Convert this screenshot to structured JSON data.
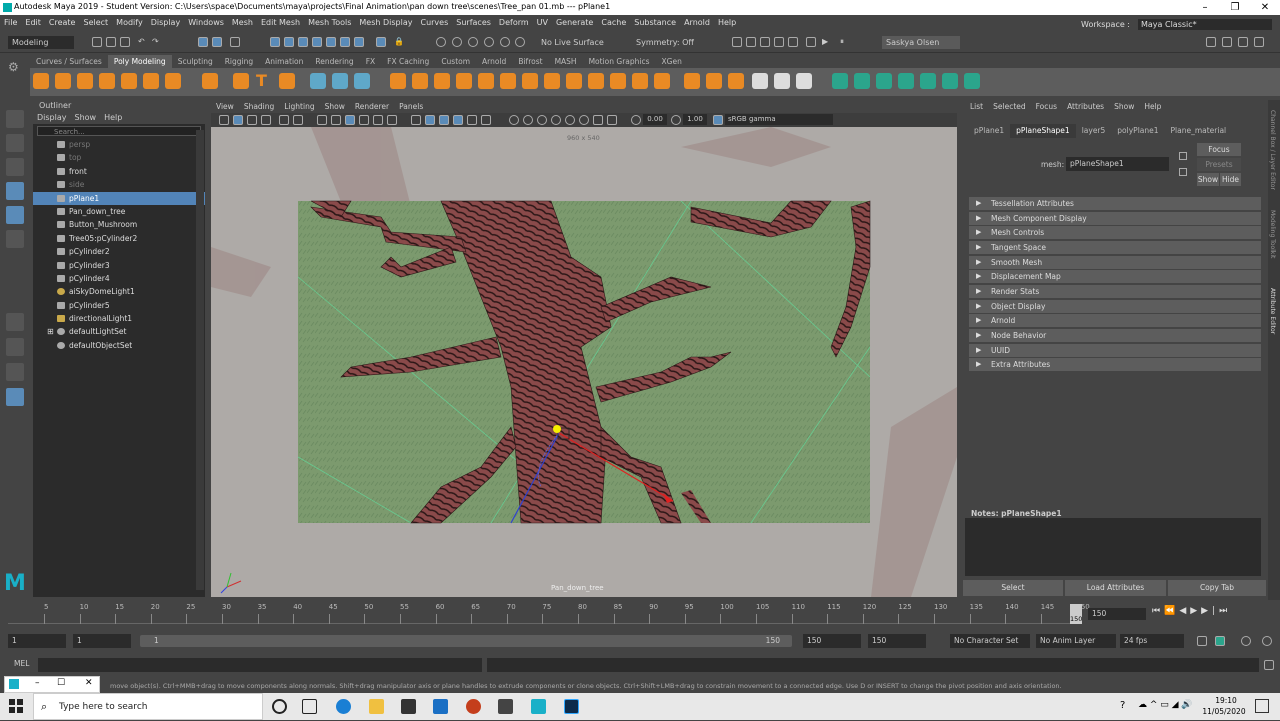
{
  "window": {
    "title": "Autodesk Maya 2019 - Student Version: C:\\Users\\space\\Documents\\maya\\projects\\Final Animation\\pan down tree\\scenes\\Tree_pan 01.mb   ---   pPlane1"
  },
  "menubar": [
    "File",
    "Edit",
    "Create",
    "Select",
    "Modify",
    "Display",
    "Windows",
    "Mesh",
    "Edit Mesh",
    "Mesh Tools",
    "Mesh Display",
    "Curves",
    "Surfaces",
    "Deform",
    "UV",
    "Generate",
    "Cache",
    "Substance",
    "Arnold",
    "Help"
  ],
  "workspace": {
    "label": "Workspace :",
    "value": "Maya Classic*"
  },
  "statusline": {
    "mode": "Modeling",
    "live_surface": "No Live Surface",
    "symmetry": "Symmetry: Off",
    "user": "Saskya Olsen"
  },
  "shelf_tabs": [
    "Curves / Surfaces",
    "Poly Modeling",
    "Sculpting",
    "Rigging",
    "Animation",
    "Rendering",
    "FX",
    "FX Caching",
    "Custom",
    "Arnold",
    "Bifrost",
    "MASH",
    "Motion Graphics",
    "XGen"
  ],
  "shelf_active": "Poly Modeling",
  "outliner": {
    "title": "Outliner",
    "menu": [
      "Display",
      "Show",
      "Help"
    ],
    "search_placeholder": "Search...",
    "items": [
      "persp",
      "top",
      "front",
      "side",
      "pPlane1",
      "Pan_down_tree",
      "Button_Mushroom",
      "Tree05:pCylinder2",
      "pCylinder2",
      "pCylinder3",
      "pCylinder4",
      "aiSkyDomeLight1",
      "pCylinder5",
      "directionalLight1",
      "defaultLightSet",
      "defaultObjectSet"
    ],
    "selected": "pPlane1"
  },
  "viewport": {
    "menu": [
      "View",
      "Shading",
      "Lighting",
      "Show",
      "Renderer",
      "Panels"
    ],
    "resolution": "960 x 540",
    "exposure": "0.00",
    "gamma": "1.00",
    "color_space": "sRGB gamma",
    "camera_name": "Pan_down_tree"
  },
  "attribute_editor": {
    "menu": [
      "List",
      "Selected",
      "Focus",
      "Attributes",
      "Show",
      "Help"
    ],
    "tabs": [
      "pPlane1",
      "pPlaneShape1",
      "layer5",
      "polyPlane1",
      "Plane_material"
    ],
    "active_tab": "pPlaneShape1",
    "mesh_label": "mesh:",
    "mesh_value": "pPlaneShape1",
    "focus": "Focus",
    "presets": "Presets",
    "show": "Show",
    "hide": "Hide",
    "sections": [
      "Tessellation Attributes",
      "Mesh Component Display",
      "Mesh Controls",
      "Tangent Space",
      "Smooth Mesh",
      "Displacement Map",
      "Render Stats",
      "Object Display",
      "Arnold",
      "Node Behavior",
      "UUID",
      "Extra Attributes"
    ],
    "notes": "Notes:  pPlaneShape1",
    "buttons": [
      "Select",
      "Load Attributes",
      "Copy Tab"
    ]
  },
  "side_tabs": [
    "Channel Box / Layer Editor",
    "Modeling Toolkit",
    "Attribute Editor"
  ],
  "timeline": {
    "ticks": [
      "5",
      "10",
      "15",
      "20",
      "25",
      "30",
      "35",
      "40",
      "45",
      "50",
      "55",
      "60",
      "65",
      "70",
      "75",
      "80",
      "85",
      "90",
      "95",
      "100",
      "105",
      "110",
      "115",
      "120",
      "125",
      "130",
      "135",
      "140",
      "145",
      "150"
    ],
    "current_frame": "150",
    "end_marker": "150"
  },
  "range": {
    "start": "1",
    "start_inner": "1",
    "range_start_label": "1",
    "range_end_label": "150",
    "end_inner": "150",
    "end": "150",
    "character_set": "No Character Set",
    "anim_layer": "No Anim Layer",
    "fps": "24 fps"
  },
  "command_line": {
    "label": "MEL"
  },
  "help_line": "move object(s). Ctrl+MMB+drag to move components along normals. Shift+drag manipulator axis or plane handles to extrude components or clone objects. Ctrl+Shift+LMB+drag to constrain movement to a connected edge. Use D or INSERT to change the pivot position and axis orientation.",
  "taskbar": {
    "search_placeholder": "Type here to search",
    "time": "19:10",
    "date": "11/05/2020"
  }
}
